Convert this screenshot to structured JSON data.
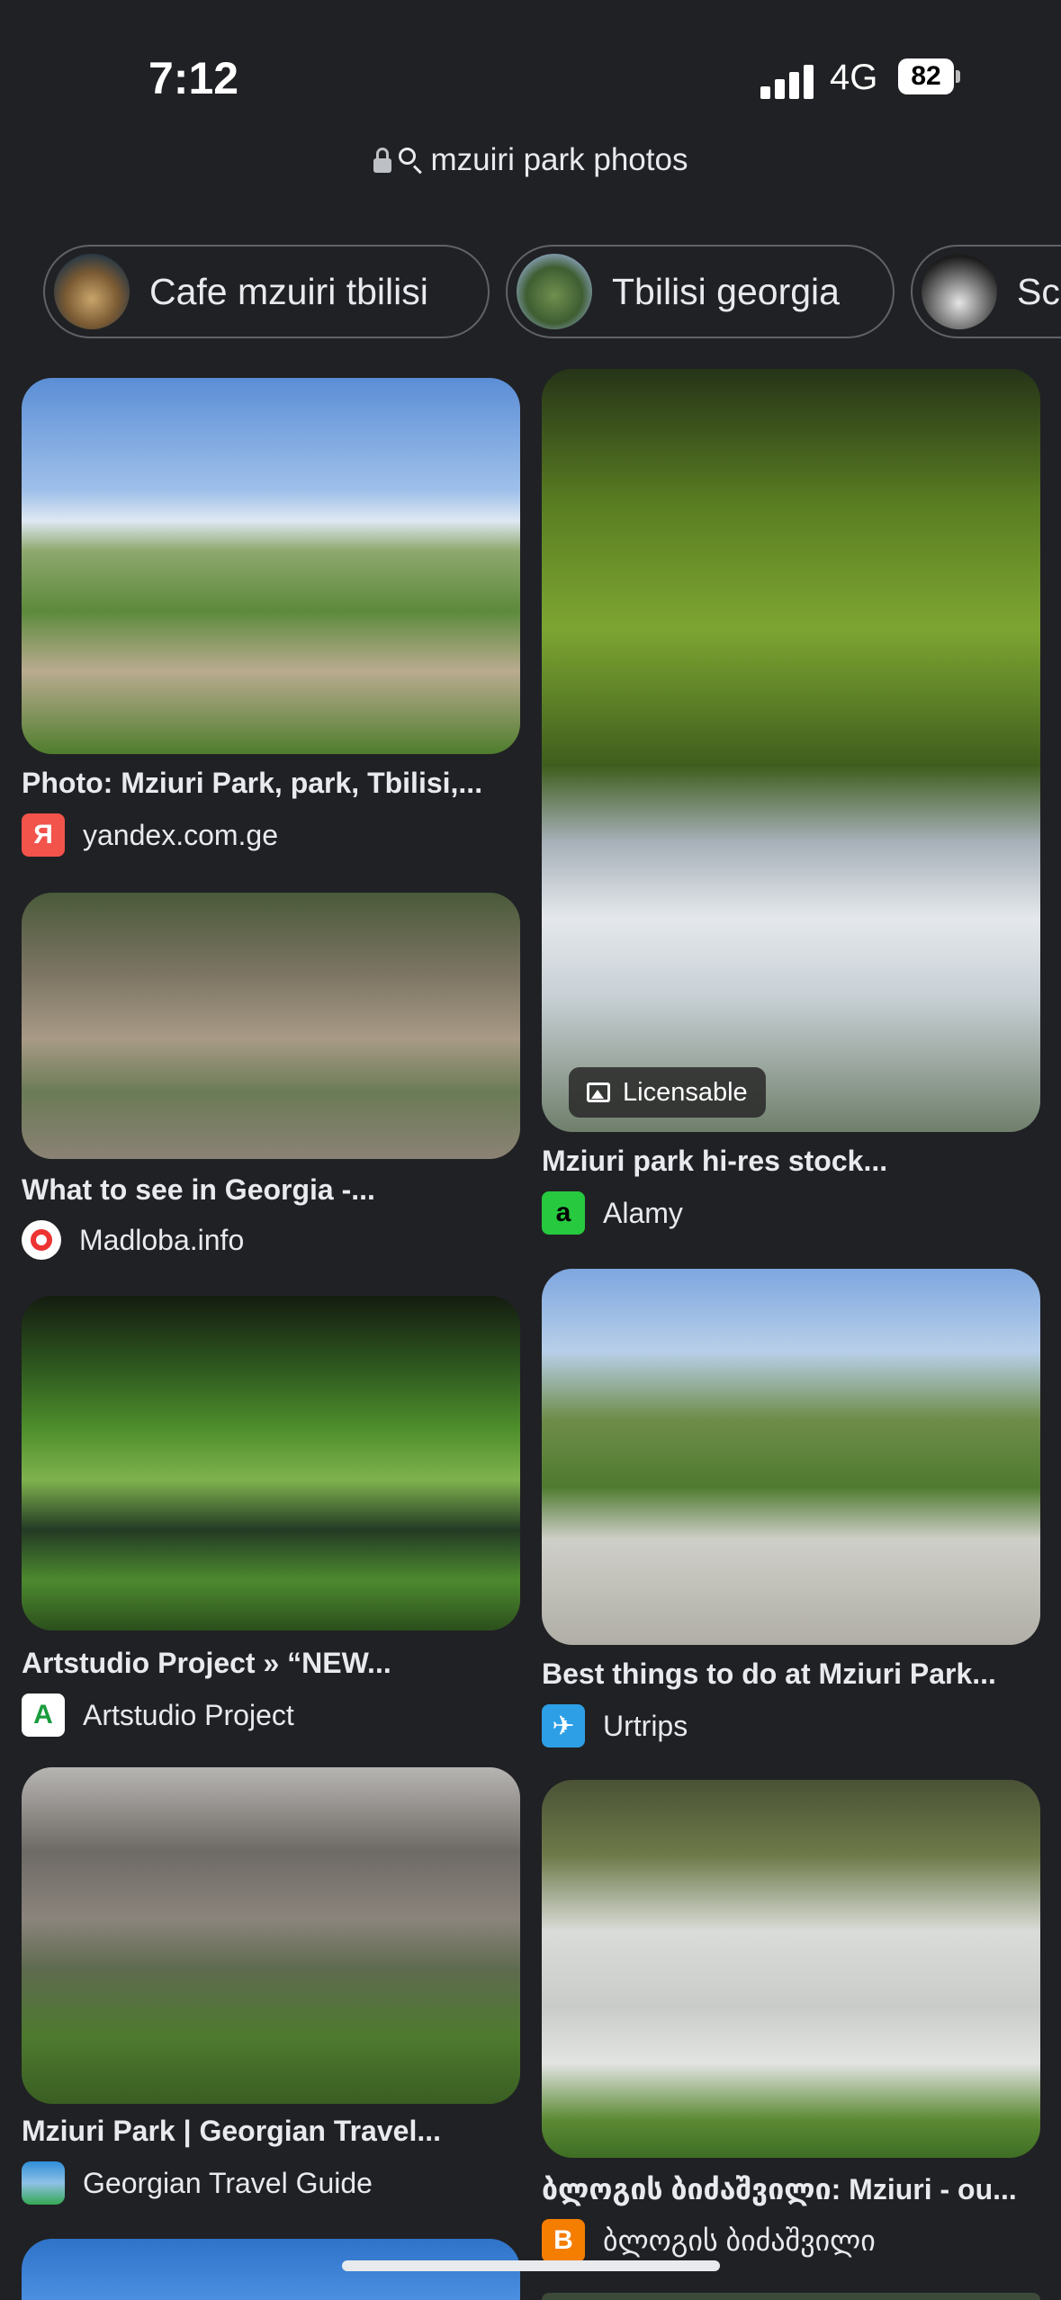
{
  "status_bar": {
    "time": "7:12",
    "network": "4G",
    "battery": "82"
  },
  "address_bar": {
    "query": "mzuiri park photos"
  },
  "chips": [
    {
      "label": "Cafe mzuiri tbilisi"
    },
    {
      "label": "Tbilisi georgia"
    },
    {
      "label": "Scu"
    }
  ],
  "results": [
    {
      "title": "Photo: Mziuri Park, park, Tbilisi,...",
      "source": "yandex.com.ge",
      "favicon": "Я"
    },
    {
      "title": "Mziuri park hi-res stock...",
      "source": "Alamy",
      "favicon": "a",
      "badge": "Licensable"
    },
    {
      "title": "What to see in Georgia -...",
      "source": "Madloba.info",
      "favicon": ""
    },
    {
      "title": "Artstudio Project » “NEW...",
      "source": "Artstudio Project",
      "favicon": "A"
    },
    {
      "title": "Best things to do at Mziuri Park...",
      "source": "Urtrips",
      "favicon": "✈"
    },
    {
      "title": "Mziuri Park | Georgian Travel...",
      "source": "Georgian Travel Guide",
      "favicon": ""
    },
    {
      "title": "ბლოგის ბიძაშვილი: Mziuri - ou...",
      "source": "ბლოგის ბიძაშვილი",
      "favicon": "B"
    }
  ],
  "colors": {
    "background": "#202124",
    "text": "#e8eaed",
    "chip_border": "#5f6368"
  }
}
